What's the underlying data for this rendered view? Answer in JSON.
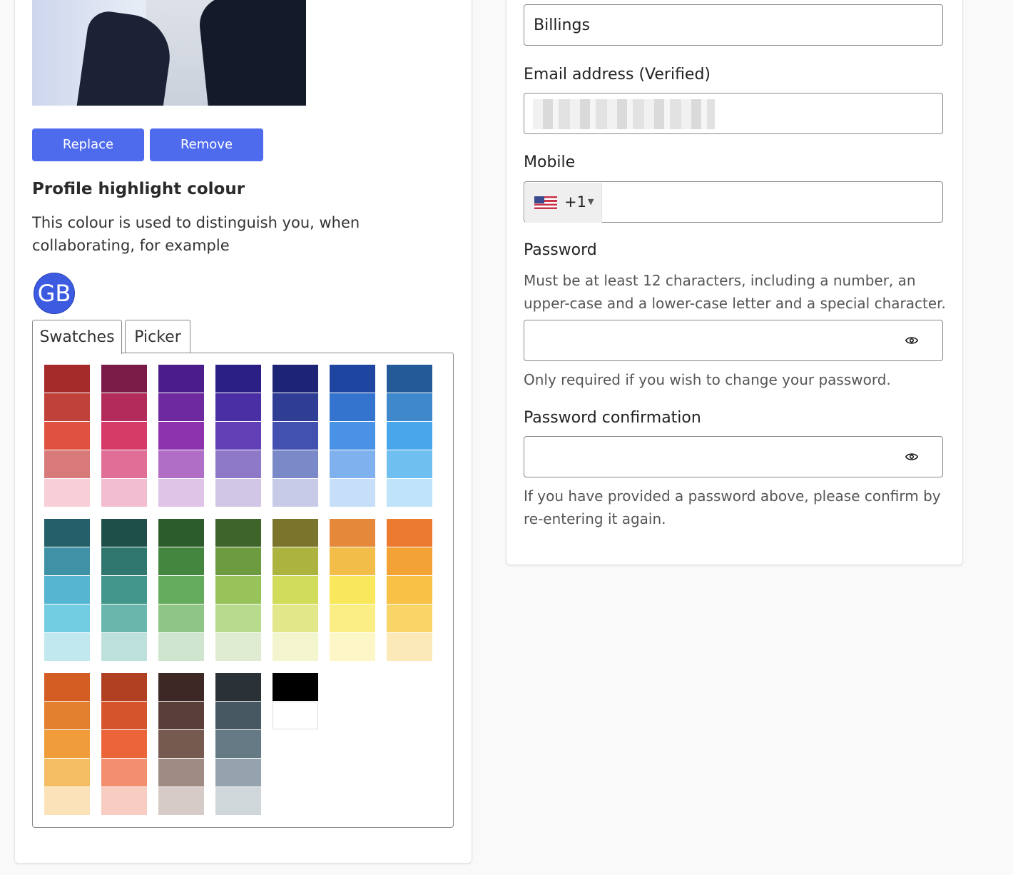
{
  "profile": {
    "replace_photo": "Replace photo",
    "remove_photo": "Remove photo",
    "highlight_title": "Profile highlight colour",
    "highlight_desc": "This colour is used to distinguish you, when collaborating, for example",
    "avatar_initials": "GB",
    "tabs": [
      "Swatches",
      "Picker"
    ],
    "swatch_groups": [
      [
        [
          "#a52a2a",
          "#c0413a",
          "#e0513f",
          "#d97a7a",
          "#f8cfd6"
        ],
        [
          "#7a1b47",
          "#b32b5a",
          "#d63a66",
          "#e06e96",
          "#f2bdd1"
        ],
        [
          "#4a1d8a",
          "#6f299e",
          "#8c33ad",
          "#b06ec6",
          "#dfc4e7"
        ],
        [
          "#2b1f86",
          "#4a2ea3",
          "#6140b5",
          "#8e79c9",
          "#d2c6e6"
        ],
        [
          "#1e2475",
          "#2f3d94",
          "#4250b0",
          "#7a89c8",
          "#c7cbe8"
        ],
        [
          "#1e45a0",
          "#3574ce",
          "#4a92e6",
          "#7fb1ef",
          "#c6def8"
        ],
        [
          "#235b99",
          "#3f88cc",
          "#4aa6ea",
          "#6fc0f1",
          "#bfe3f8"
        ]
      ],
      [
        [
          "#255f6a",
          "#3f91a6",
          "#56b6d2",
          "#72cde2",
          "#c2e8ef"
        ],
        [
          "#1e4f48",
          "#2f766e",
          "#43968c",
          "#68b6ac",
          "#bee0dc"
        ],
        [
          "#2d5c2c",
          "#43863f",
          "#65ab5d",
          "#90c685",
          "#cfe5ce"
        ],
        [
          "#3f6429",
          "#6d9b40",
          "#98c35b",
          "#b8da8c",
          "#e0ecd1"
        ],
        [
          "#7a742c",
          "#adb33f",
          "#d1dc5b",
          "#e2e88a",
          "#f2f5cd"
        ],
        [
          "#e6883a",
          "#f2bd48",
          "#fae85c",
          "#fbee85",
          "#fdf7c7"
        ],
        [
          "#ec7a30",
          "#f3a235",
          "#f6c145",
          "#f8d566",
          "#fbe9b8"
        ]
      ],
      [
        [
          "#d45d24",
          "#e38030",
          "#f09c3a",
          "#f4bd63",
          "#fbe2b8"
        ],
        [
          "#b14022",
          "#d6542c",
          "#eb643a",
          "#f28f6e",
          "#f8ccc1"
        ],
        [
          "#3d2825",
          "#5a3f39",
          "#775a4f",
          "#9f8b82",
          "#d7cbc7"
        ],
        [
          "#2a3137",
          "#475863",
          "#667a86",
          "#94a3ad",
          "#d0d7da"
        ],
        [
          "#000000",
          "#ffffff"
        ]
      ]
    ]
  },
  "account": {
    "city_value": "Billings",
    "email_label": "Email address (Verified)",
    "mobile_label": "Mobile",
    "country_code": "+1",
    "country_flag": "us-flag-icon",
    "password_label": "Password",
    "password_hint": "Must be at least 12 characters, including a number, an upper-case and a lower-case letter and a special character.",
    "password_help": "Only required if you wish to change your password.",
    "confirm_label": "Password confirmation",
    "confirm_help": "If you have provided a password above, please confirm by re-entering it again."
  },
  "colors": {
    "primary": "#4f6bed",
    "avatar": "#3d5be0"
  }
}
